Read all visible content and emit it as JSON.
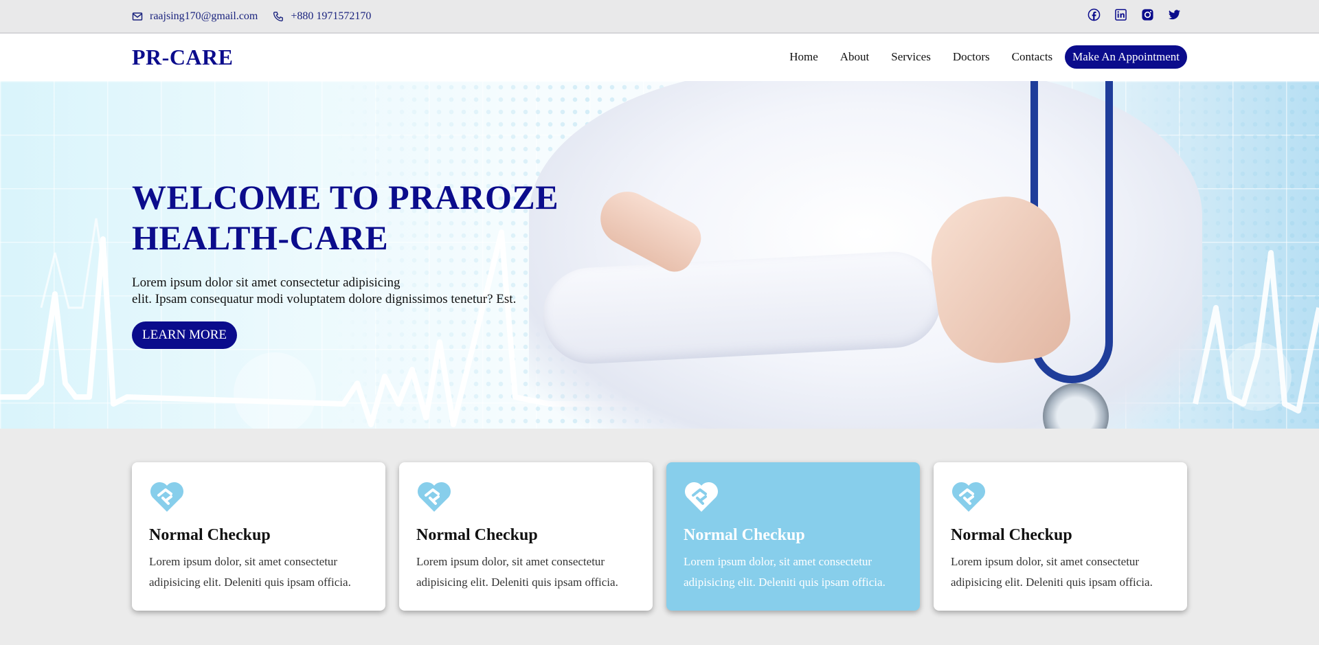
{
  "topbar": {
    "email": "raajsing170@gmail.com",
    "phone": "+880 1971572170",
    "social": [
      "facebook-icon",
      "linkedin-icon",
      "instagram-icon",
      "twitter-icon"
    ]
  },
  "nav": {
    "logo": "PR-CARE",
    "items": [
      "Home",
      "About",
      "Services",
      "Doctors",
      "Contacts"
    ],
    "appointment": "Make An Appointment"
  },
  "hero": {
    "title_line1": "WELCOME TO PRAROZE",
    "title_line2": "HEALTH-CARE",
    "text_line1": "Lorem ipsum dolor sit amet consectetur adipisicing",
    "text_line2": "elit. Ipsam consequatur modi voluptatem dolore dignissimos tenetur? Est.",
    "button": "LEARN MORE"
  },
  "cards": [
    {
      "title": "Normal Checkup",
      "text": "Lorem ipsum dolor, sit amet consectetur adipisicing elit. Deleniti quis ipsam officia.",
      "icon": "heart-handshake-icon"
    },
    {
      "title": "Normal Checkup",
      "text": "Lorem ipsum dolor, sit amet consectetur adipisicing elit. Deleniti quis ipsam officia.",
      "icon": "heart-handshake-icon"
    },
    {
      "title": "Normal Checkup",
      "text": "Lorem ipsum dolor, sit amet consectetur adipisicing elit. Deleniti quis ipsam officia.",
      "icon": "heart-handshake-icon"
    },
    {
      "title": "Normal Checkup",
      "text": "Lorem ipsum dolor, sit amet consectetur adipisicing elit. Deleniti quis ipsam officia.",
      "icon": "heart-handshake-icon"
    }
  ],
  "colors": {
    "brand": "#0b0c8c",
    "card_highlight": "#87ceeb",
    "icon": "#87ceeb"
  }
}
